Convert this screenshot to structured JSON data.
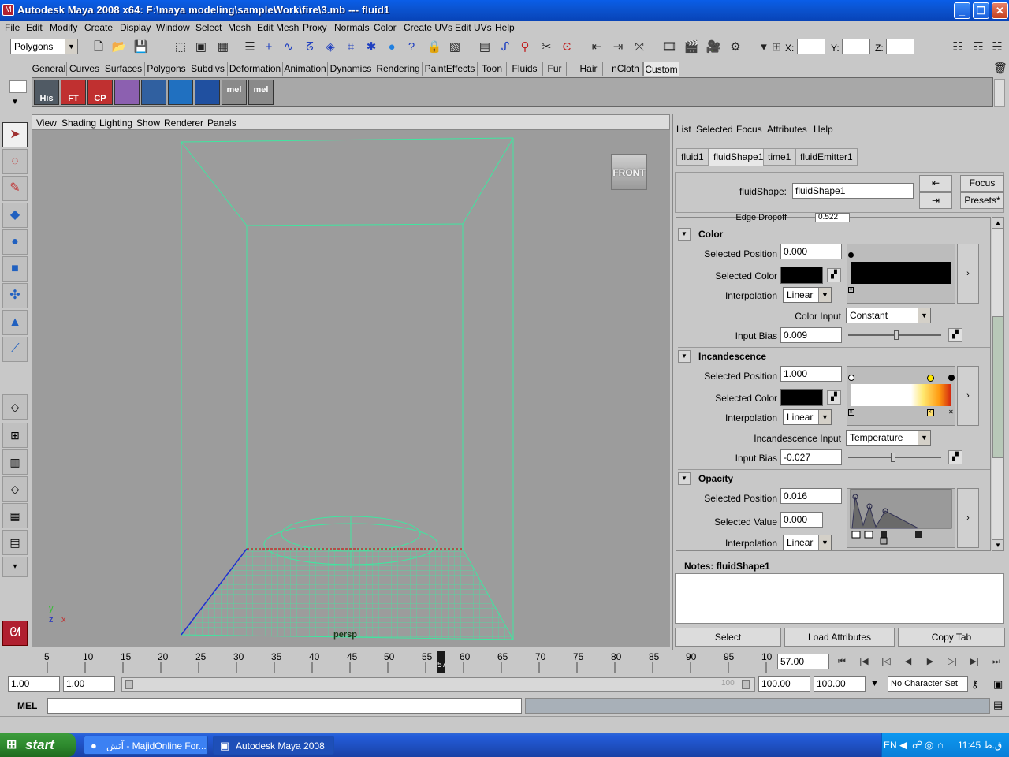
{
  "window": {
    "title": "Autodesk Maya 2008 x64: F:\\maya modeling\\sampleWork\\fire\\3.mb   ---   fluid1",
    "minimize": "_",
    "maximize": "❐",
    "close": "✕"
  },
  "menubar": [
    "File",
    "Edit",
    "Modify",
    "Create",
    "Display",
    "Window",
    "Select",
    "Mesh",
    "Edit Mesh",
    "Proxy",
    "Normals",
    "Color",
    "Create UVs",
    "Edit UVs",
    "Help"
  ],
  "statusline": {
    "mode": "Polygons",
    "x_label": "X:",
    "y_label": "Y:",
    "z_label": "Z:"
  },
  "shelf": {
    "tabs": [
      "General",
      "Curves",
      "Surfaces",
      "Polygons",
      "Subdivs",
      "Deformation",
      "Animation",
      "Dynamics",
      "Rendering",
      "PaintEffects",
      "Toon",
      "Fluids",
      "Fur",
      "Hair",
      "nCloth",
      "Custom"
    ],
    "active_tab": "Custom",
    "icons": [
      "His",
      "FT",
      "CP",
      "",
      "",
      "",
      "",
      "mel",
      "mel"
    ]
  },
  "viewport": {
    "menu": [
      "View",
      "Shading",
      "Lighting",
      "Show",
      "Renderer",
      "Panels"
    ],
    "camera_label": "persp",
    "viewcube": "FRONT",
    "axis_y": "y",
    "axis_z": "z",
    "axis_x": "x"
  },
  "attribute_editor": {
    "menu": [
      "List",
      "Selected",
      "Focus",
      "Attributes",
      "Help"
    ],
    "tabs": [
      "fluid1",
      "fluidShape1",
      "time1",
      "fluidEmitter1"
    ],
    "active_tab": "fluidShape1",
    "node_label": "fluidShape:",
    "node_value": "fluidShape1",
    "focus_button": "Focus",
    "presets_button": "Presets*",
    "partial_row": "Edge Dropoff",
    "partial_value": "0.522",
    "color": {
      "header": "Color",
      "selected_position_label": "Selected Position",
      "selected_position": "0.000",
      "selected_color_label": "Selected Color",
      "interpolation_label": "Interpolation",
      "interpolation": "Linear",
      "color_input_label": "Color Input",
      "color_input": "Constant",
      "input_bias_label": "Input Bias",
      "input_bias": "0.009",
      "input_bias_fraction": 0.52
    },
    "incandescence": {
      "header": "Incandescence",
      "selected_position_label": "Selected Position",
      "selected_position": "1.000",
      "selected_color_label": "Selected Color",
      "interpolation_label": "Interpolation",
      "interpolation": "Linear",
      "input_label": "Incandescence Input",
      "input": "Temperature",
      "input_bias_label": "Input Bias",
      "input_bias": "-0.027",
      "input_bias_fraction": 0.48
    },
    "opacity": {
      "header": "Opacity",
      "selected_position_label": "Selected Position",
      "selected_position": "0.016",
      "selected_value_label": "Selected Value",
      "selected_value": "0.000",
      "interpolation_label": "Interpolation",
      "interpolation": "Linear"
    },
    "ramp_arrow": "›",
    "notes_label": "Notes:  fluidShape1",
    "buttons": [
      "Select",
      "Load Attributes",
      "Copy Tab"
    ]
  },
  "timeline": {
    "ticks": [
      "5",
      "10",
      "15",
      "20",
      "25",
      "30",
      "35",
      "40",
      "45",
      "50",
      "55",
      "60",
      "65",
      "70",
      "75",
      "80",
      "85",
      "90",
      "95",
      "10"
    ],
    "current_frame_marker": "57",
    "current_time": "57.00",
    "playback_symbols": [
      "⏮",
      "|◀",
      "|◁",
      "◀",
      "▶",
      "▷|",
      "▶|",
      "⏭"
    ]
  },
  "range": {
    "start": "1.00",
    "playback_start": "1.00",
    "range_end_marker": "100",
    "playback_end": "100.00",
    "end": "100.00",
    "character_set": "No Character Set"
  },
  "command_line": {
    "label": "MEL"
  },
  "taskbar": {
    "start": "start",
    "tasks": [
      "آتش - MajidOnline For...",
      "Autodesk Maya 2008 ..."
    ],
    "lang": "EN",
    "clock": "11:45 ق.ظ"
  }
}
